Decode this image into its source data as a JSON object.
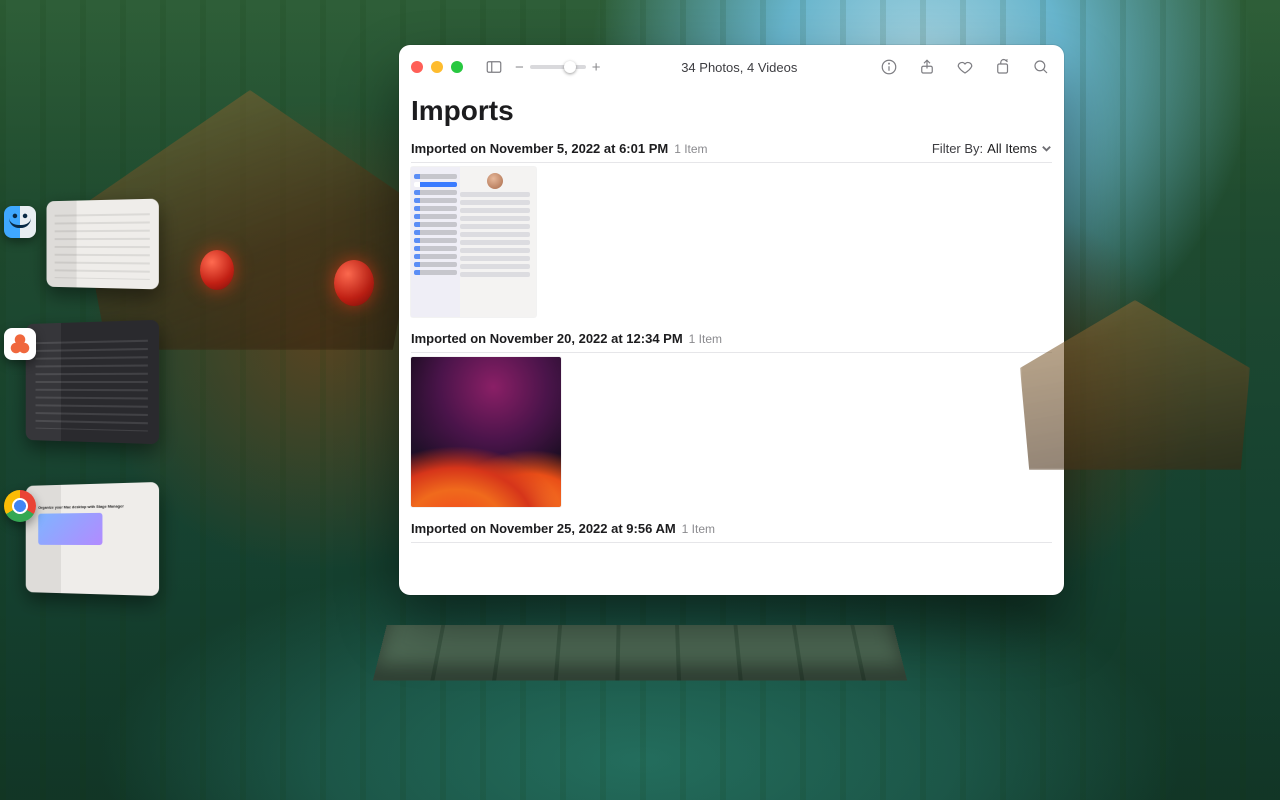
{
  "stage_manager": {
    "groups": [
      {
        "app_name": "finder"
      },
      {
        "app_name": "asana"
      },
      {
        "app_name": "chrome",
        "doc_title": "Organize your Mac desktop with Stage Manager"
      }
    ]
  },
  "photos_window": {
    "toolbar": {
      "title": "34 Photos, 4 Videos",
      "zoom_out": "−",
      "zoom_in": "+"
    },
    "heading": "Imports",
    "filter": {
      "prefix": "Filter By:",
      "value": "All Items"
    },
    "groups": [
      {
        "label": "Imported on November 5, 2022 at 6:01 PM",
        "count": "1 Item",
        "thumb": "settings"
      },
      {
        "label": "Imported on November 20, 2022 at 12:34 PM",
        "count": "1 Item",
        "thumb": "ventura"
      },
      {
        "label": "Imported on November 25, 2022 at 9:56 AM",
        "count": "1 Item",
        "thumb": "none"
      }
    ]
  }
}
